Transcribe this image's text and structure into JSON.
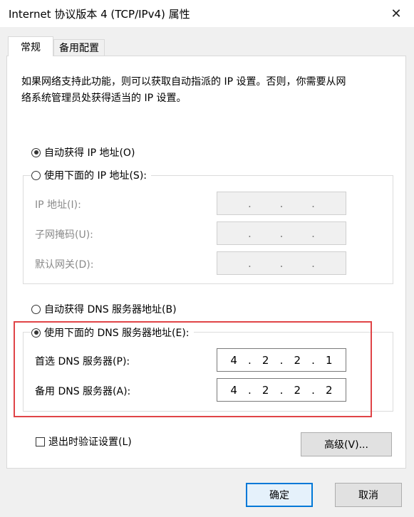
{
  "window": {
    "title": "Internet 协议版本 4 (TCP/IPv4) 属性",
    "close_glyph": "✕"
  },
  "tabs": [
    {
      "label": "常规",
      "active": true
    },
    {
      "label": "备用配置",
      "active": false
    }
  ],
  "description": {
    "line1": "如果网络支持此功能，则可以获取自动指派的 IP 设置。否则，你需要从网",
    "line2": "络系统管理员处获得适当的 IP 设置。"
  },
  "ip": {
    "auto_label": "自动获得 IP 地址(O)",
    "auto_checked": true,
    "manual_label": "使用下面的 IP 地址(S):",
    "manual_checked": false,
    "fields": [
      {
        "label": "IP 地址(I):",
        "octets": [
          "",
          "",
          "",
          ""
        ],
        "sep": "."
      },
      {
        "label": "子网掩码(U):",
        "octets": [
          "",
          "",
          "",
          ""
        ],
        "sep": "."
      },
      {
        "label": "默认网关(D):",
        "octets": [
          "",
          "",
          "",
          ""
        ],
        "sep": "."
      }
    ]
  },
  "dns": {
    "auto_label": "自动获得 DNS 服务器地址(B)",
    "auto_checked": false,
    "manual_label": "使用下面的 DNS 服务器地址(E):",
    "manual_checked": true,
    "fields": [
      {
        "label": "首选 DNS 服务器(P):",
        "octets": [
          "4",
          "2",
          "2",
          "1"
        ],
        "sep": "."
      },
      {
        "label": "备用 DNS 服务器(A):",
        "octets": [
          "4",
          "2",
          "2",
          "2"
        ],
        "sep": "."
      }
    ]
  },
  "validate": {
    "label": "退出时验证设置(L)",
    "checked": false
  },
  "buttons": {
    "advanced": "高级(V)...",
    "ok": "确定",
    "cancel": "取消"
  },
  "colors": {
    "highlight": "#e04447",
    "accent": "#0078d7"
  }
}
